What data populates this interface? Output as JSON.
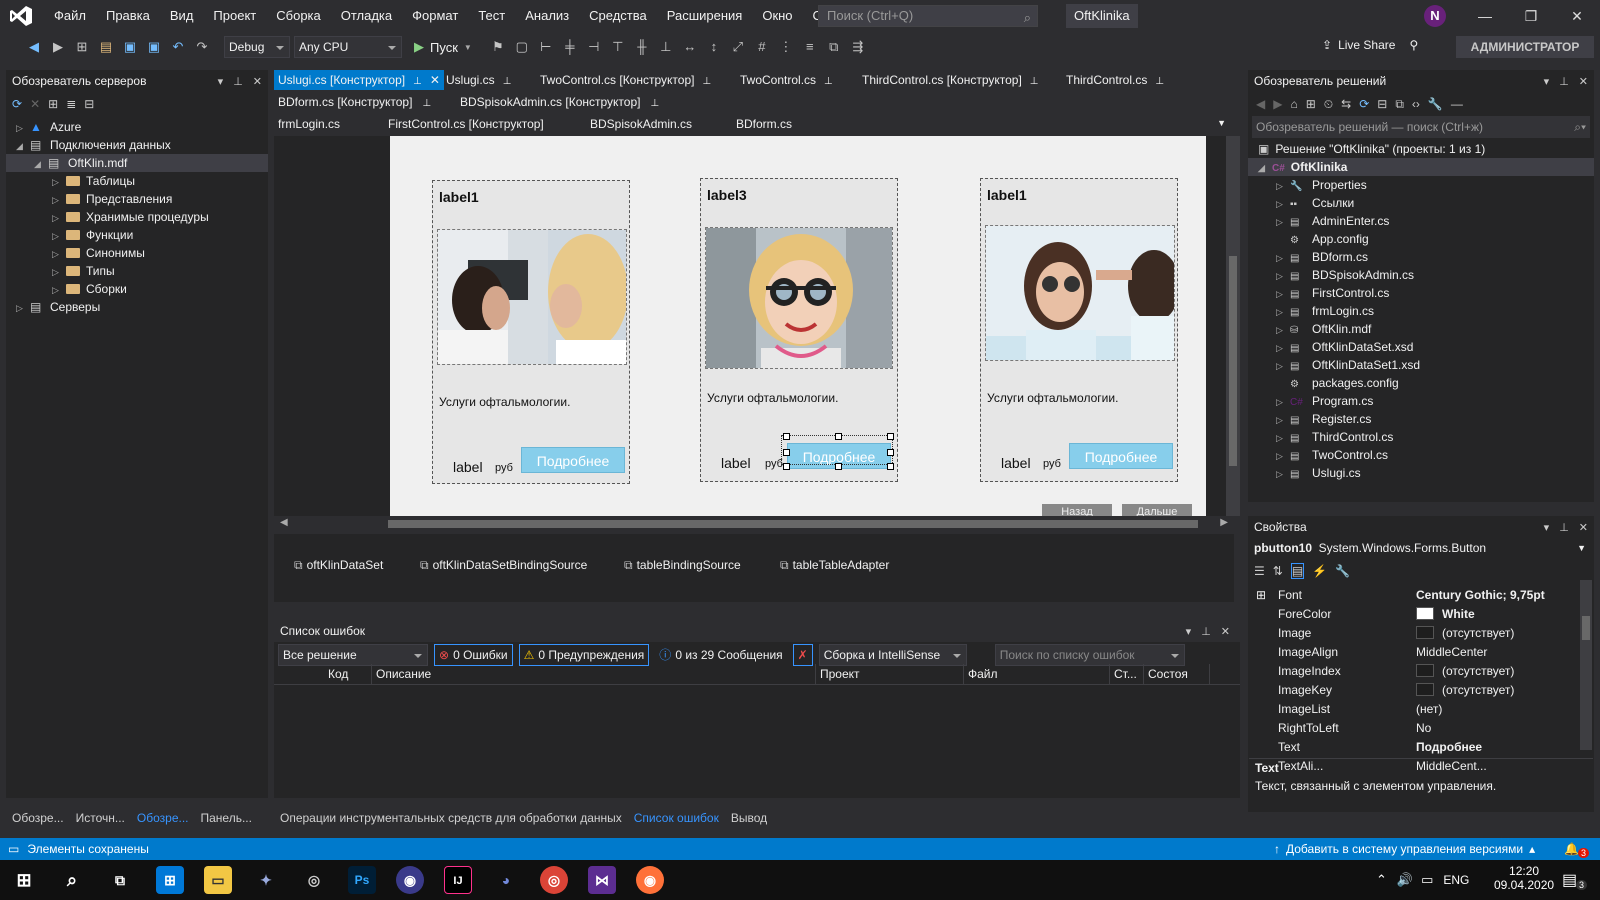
{
  "menu": [
    "Файл",
    "Правка",
    "Вид",
    "Проект",
    "Сборка",
    "Отладка",
    "Формат",
    "Тест",
    "Анализ",
    "Средства",
    "Расширения",
    "Окно",
    "Справка"
  ],
  "search_placeholder": "Поиск (Ctrl+Q)",
  "app_title": "OftKlinika",
  "user_initial": "N",
  "toolbar": {
    "config": "Debug",
    "platform": "Any CPU",
    "run": "Пуск",
    "live_share": "Live Share",
    "admin": "АДМИНИСТРАТОР"
  },
  "server_explorer": {
    "title": "Обозреватель серверов",
    "items": [
      {
        "label": "Azure",
        "level": 0,
        "arrow": "▷"
      },
      {
        "label": "Подключения данных",
        "level": 0,
        "arrow": "◢"
      },
      {
        "label": "OftKlin.mdf",
        "level": 1,
        "arrow": "◢"
      },
      {
        "label": "Таблицы",
        "level": 2,
        "arrow": "▷"
      },
      {
        "label": "Представления",
        "level": 2,
        "arrow": "▷"
      },
      {
        "label": "Хранимые процедуры",
        "level": 2,
        "arrow": "▷"
      },
      {
        "label": "Функции",
        "level": 2,
        "arrow": "▷"
      },
      {
        "label": "Синонимы",
        "level": 2,
        "arrow": "▷"
      },
      {
        "label": "Типы",
        "level": 2,
        "arrow": "▷"
      },
      {
        "label": "Сборки",
        "level": 2,
        "arrow": "▷"
      },
      {
        "label": "Серверы",
        "level": 0,
        "arrow": "▷"
      }
    ]
  },
  "left_bottom_tabs": [
    "Обозре...",
    "Источн...",
    "Обозре...",
    "Панель..."
  ],
  "doc_tabs": {
    "row1": [
      "Uslugi.cs [Конструктор]",
      "Uslugi.cs",
      "TwoControl.cs [Конструктор]",
      "TwoControl.cs",
      "ThirdControl.cs [Конструктор]",
      "ThirdControl.cs"
    ],
    "row2": [
      "BDform.cs [Конструктор]",
      "BDSpisokAdmin.cs [Конструктор]"
    ],
    "row3": [
      "frmLogin.cs",
      "FirstControl.cs [Конструктор]",
      "BDSpisokAdmin.cs",
      "BDform.cs"
    ]
  },
  "cards": [
    {
      "title": "label1",
      "desc": "Услуги офтальмологии.",
      "price": "label",
      "currency": "руб",
      "button": "Подробнее"
    },
    {
      "title": "label3",
      "desc": "Услуги офтальмологии.",
      "price": "label",
      "currency": "руб",
      "button": "Подробнее"
    },
    {
      "title": "label1",
      "desc": "Услуги офтальмологии.",
      "price": "label",
      "currency": "руб",
      "button": "Подробнее"
    }
  ],
  "nav": {
    "back": "Назад",
    "next": "Дальше"
  },
  "tray": [
    "oftKlinDataSet",
    "oftKlinDataSetBindingSource",
    "tableBindingSource",
    "tableTableAdapter"
  ],
  "error_list": {
    "title": "Список ошибок",
    "scope": "Все решение",
    "errors": "0 Ошибки",
    "warnings": "0 Предупреждения",
    "messages": "0 из 29 Сообщения",
    "build": "Сборка и IntelliSense",
    "search": "Поиск по списку ошибок",
    "columns": [
      "Код",
      "Описание",
      "Проект",
      "Файл",
      "Ст...",
      "Состоя"
    ]
  },
  "bottom_tabs": [
    "Операции инструментальных средств для обработки данных",
    "Список ошибок",
    "Вывод"
  ],
  "solution": {
    "title": "Обозреватель решений",
    "search": "Обозреватель решений — поиск (Ctrl+ж)",
    "root": "Решение \"OftKlinika\" (проекты: 1 из 1)",
    "project": "OftKlinika",
    "items": [
      "Properties",
      "Ссылки",
      "AdminEnter.cs",
      "App.config",
      "BDform.cs",
      "BDSpisokAdmin.cs",
      "FirstControl.cs",
      "frmLogin.cs",
      "OftKlin.mdf",
      "OftKlinDataSet.xsd",
      "OftKlinDataSet1.xsd",
      "packages.config",
      "Program.cs",
      "Register.cs",
      "ThirdControl.cs",
      "TwoControl.cs",
      "Uslugi.cs"
    ]
  },
  "properties": {
    "title": "Свойства",
    "object": "pbutton10",
    "type": "System.Windows.Forms.Button",
    "rows": [
      {
        "k": "Font",
        "v": "Century Gothic; 9,75pt",
        "bold": true
      },
      {
        "k": "ForeColor",
        "v": "White",
        "bold": true,
        "swatch": "#ffffff"
      },
      {
        "k": "Image",
        "v": "(отсутствует)",
        "swatch": "#1e1e1e"
      },
      {
        "k": "ImageAlign",
        "v": "MiddleCenter"
      },
      {
        "k": "ImageIndex",
        "v": "(отсутствует)",
        "swatch": "#1e1e1e"
      },
      {
        "k": "ImageKey",
        "v": "(отсутствует)",
        "swatch": "#1e1e1e"
      },
      {
        "k": "ImageList",
        "v": "(нет)"
      },
      {
        "k": "RightToLeft",
        "v": "No"
      },
      {
        "k": "Text",
        "v": "Подробнее",
        "bold": true
      },
      {
        "k": "TextAli...",
        "v": "MiddleCent..."
      }
    ],
    "desc_title": "Text",
    "desc": "Текст, связанный с элементом управления."
  },
  "status": {
    "left": "Элементы сохранены",
    "right": "Добавить в систему управления версиями",
    "badge": "3"
  },
  "clock": {
    "time": "12:20",
    "date": "09.04.2020",
    "lang": "ENG",
    "notif": "3"
  }
}
